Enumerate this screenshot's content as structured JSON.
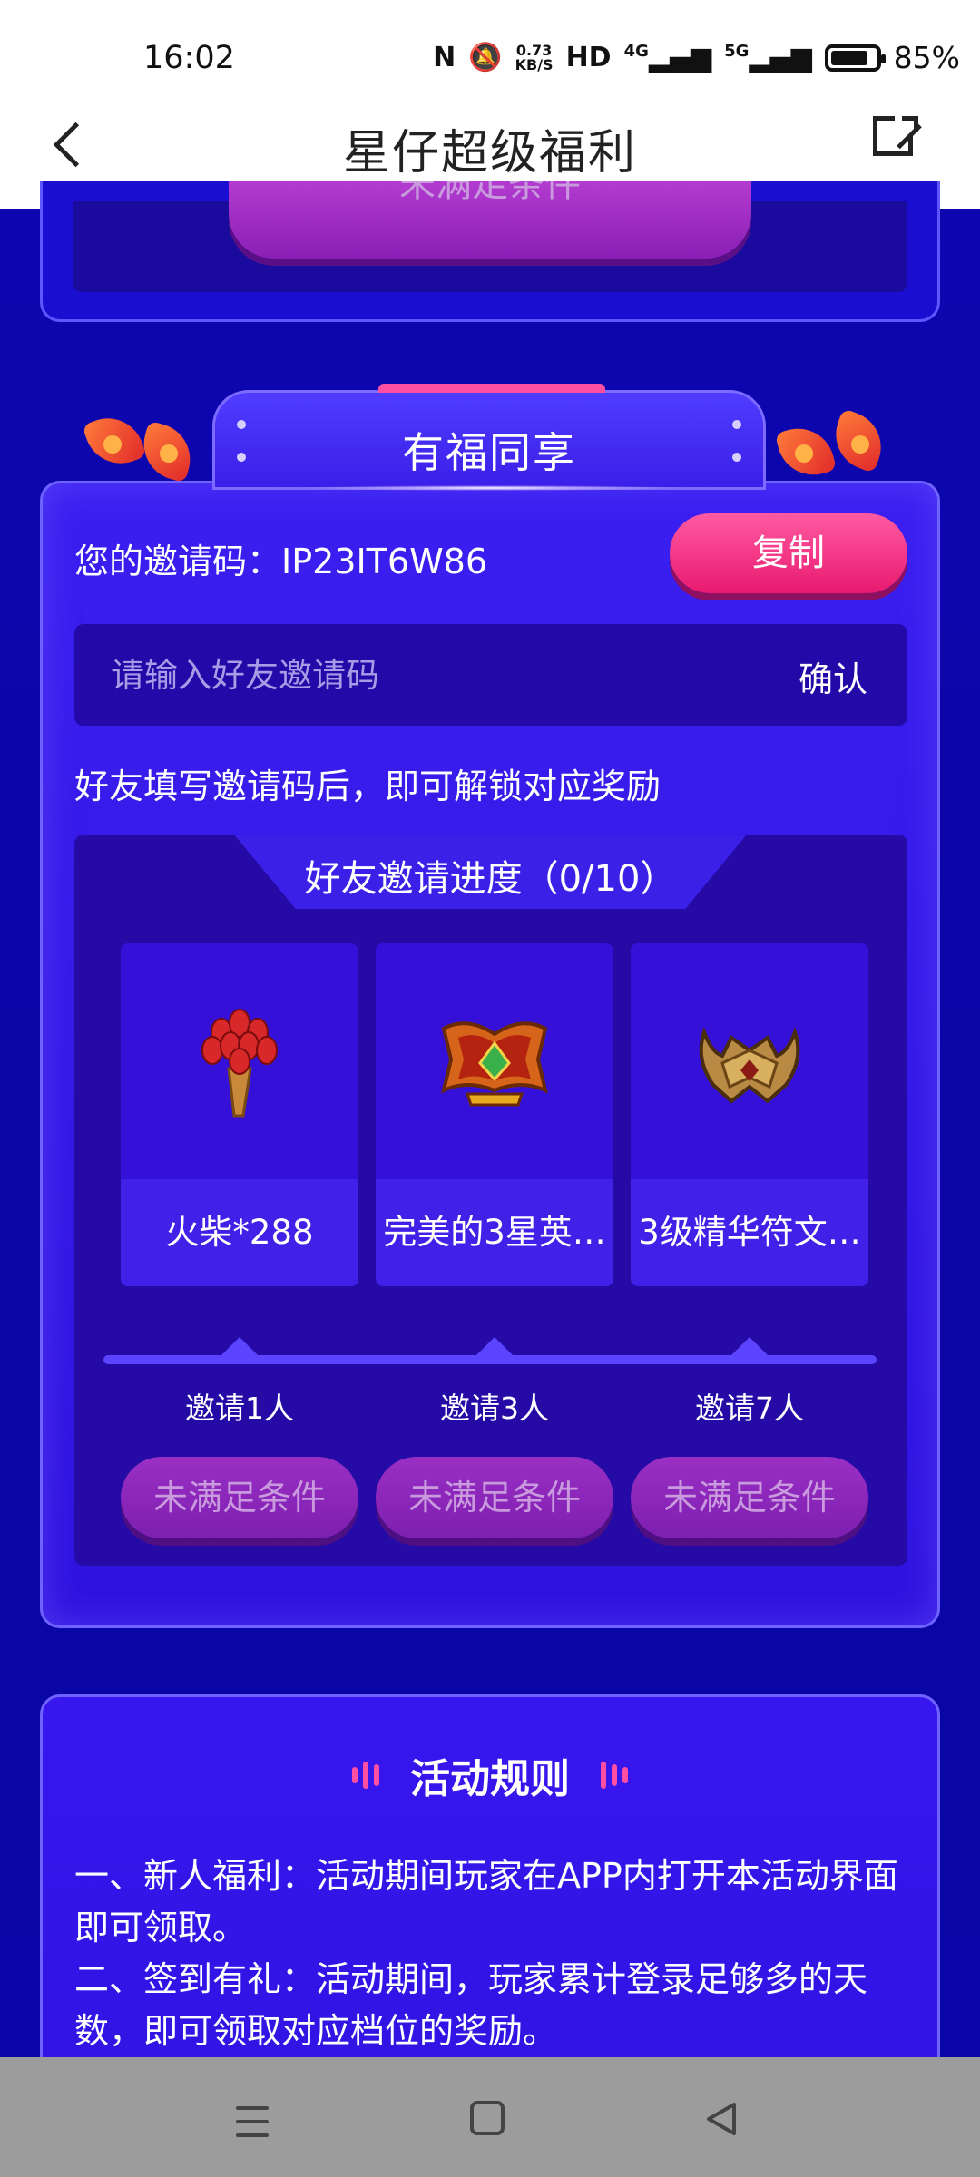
{
  "status_bar": {
    "time": "16:02",
    "net_speed_value": "0.73",
    "net_speed_unit": "KB/S",
    "hd_label": "HD",
    "signal_4g": "4G",
    "signal_5g": "5G",
    "battery_pct": "85%",
    "battery_level": 0.85
  },
  "header": {
    "title": "星仔超级福利"
  },
  "prev_section": {
    "button_label": "未满足条件"
  },
  "invite": {
    "title": "有福同享",
    "code_label": "您的邀请码：IP23IT6W86",
    "copy_label": "复制",
    "input_placeholder": "请输入好友邀请码",
    "confirm_label": "确认",
    "hint": "好友填写邀请码后，即可解锁对应奖励",
    "progress_title": "好友邀请进度（0/10）",
    "progress_done": 0,
    "progress_total": 10,
    "rewards": [
      {
        "name": "火柴*288",
        "icon": "torch-bouquet-icon",
        "milestone": "邀请1人",
        "button": "未满足条件"
      },
      {
        "name": "完美的3星英…",
        "icon": "winged-banner-icon",
        "milestone": "邀请3人",
        "button": "未满足条件"
      },
      {
        "name": "3级精华符文…",
        "icon": "horned-crown-icon",
        "milestone": "邀请7人",
        "button": "未满足条件"
      }
    ]
  },
  "rules": {
    "title": "活动规则",
    "lines": [
      "一、新人福利：活动期间玩家在APP内打开本活动界面即可领取。",
      "二、签到有礼：活动期间，玩家累计登录足够多的天数，即可领取对应档位的奖励。"
    ]
  },
  "nav": {
    "menu_icon": "menu-icon",
    "home_icon": "home-square-icon",
    "back_icon": "back-triangle-icon"
  },
  "colors": {
    "page_bg": "#0b06a9",
    "card_bg": "#3a1ff0",
    "accent_pink": "#ff4fa3",
    "disabled_button": "#8a25ba"
  }
}
